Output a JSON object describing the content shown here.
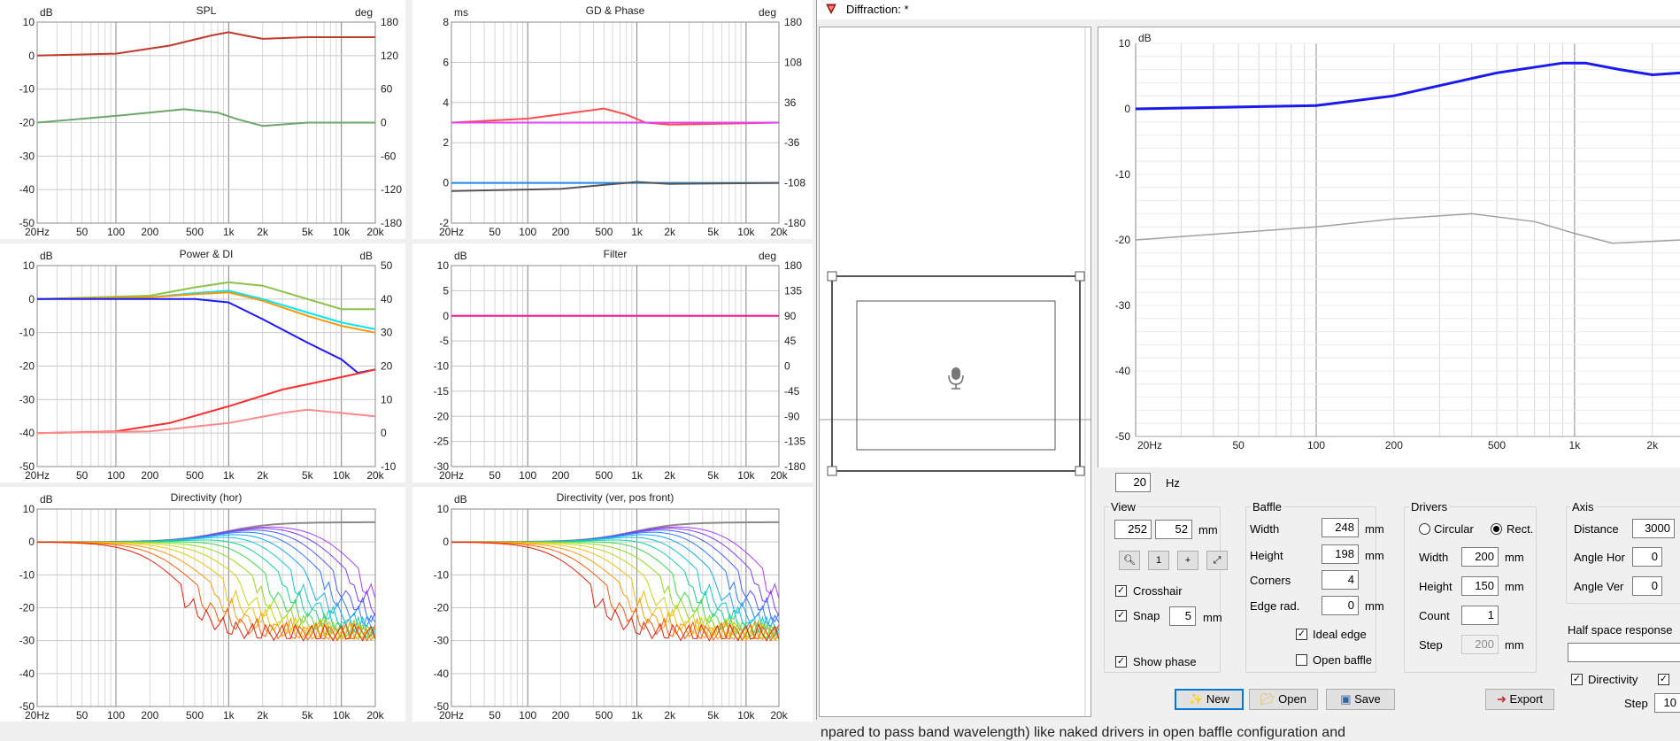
{
  "charts": [
    {
      "id": "spl",
      "title": "SPL",
      "lunit": "dB",
      "runit": "deg",
      "lticks": [
        "10",
        "0",
        "-10",
        "-20",
        "-30",
        "-40",
        "-50"
      ],
      "rticks": [
        "180",
        "120",
        "60",
        "0",
        "-60",
        "-120",
        "-180"
      ],
      "xticks": [
        "20Hz",
        "50",
        "100",
        "200",
        "500",
        "1k",
        "2k",
        "5k",
        "10k",
        "20k"
      ]
    },
    {
      "id": "gd",
      "title": "GD & Phase",
      "lunit": "ms",
      "runit": "deg",
      "lticks": [
        "8",
        "6",
        "4",
        "2",
        "0",
        "-2"
      ],
      "rticks": [
        "180",
        "108",
        "36",
        "-36",
        "-108",
        "-180"
      ],
      "xticks": [
        "20Hz",
        "50",
        "100",
        "200",
        "500",
        "1k",
        "2k",
        "5k",
        "10k",
        "20k"
      ]
    },
    {
      "id": "power",
      "title": "Power & DI",
      "lunit": "dB",
      "runit": "dB",
      "lticks": [
        "10",
        "0",
        "-10",
        "-20",
        "-30",
        "-40",
        "-50"
      ],
      "rticks": [
        "50",
        "40",
        "30",
        "20",
        "10",
        "0",
        "-10"
      ],
      "xticks": [
        "20Hz",
        "50",
        "100",
        "200",
        "500",
        "1k",
        "2k",
        "5k",
        "10k",
        "20k"
      ]
    },
    {
      "id": "filter",
      "title": "Filter",
      "lunit": "dB",
      "runit": "deg",
      "lticks": [
        "10",
        "5",
        "0",
        "-5",
        "-10",
        "-15",
        "-20",
        "-25",
        "-30"
      ],
      "rticks": [
        "180",
        "135",
        "90",
        "45",
        "0",
        "-45",
        "-90",
        "-135",
        "-180"
      ],
      "xticks": [
        "20Hz",
        "50",
        "100",
        "200",
        "500",
        "1k",
        "2k",
        "5k",
        "10k",
        "20k"
      ]
    },
    {
      "id": "dirh",
      "title": "Directivity (hor)",
      "lunit": "dB",
      "runit": "",
      "lticks": [
        "10",
        "0",
        "-10",
        "-20",
        "-30",
        "-40",
        "-50"
      ],
      "rticks": [],
      "xticks": [
        "20Hz",
        "50",
        "100",
        "200",
        "500",
        "1k",
        "2k",
        "5k",
        "10k",
        "20k"
      ]
    },
    {
      "id": "dirv",
      "title": "Directivity (ver, pos front)",
      "lunit": "dB",
      "runit": "",
      "lticks": [
        "10",
        "0",
        "-10",
        "-20",
        "-30",
        "-40",
        "-50"
      ],
      "rticks": [],
      "xticks": [
        "20Hz",
        "50",
        "100",
        "200",
        "500",
        "1k",
        "2k",
        "5k",
        "10k",
        "20k"
      ]
    }
  ],
  "chart_data": [
    {
      "type": "line",
      "title": "SPL",
      "ylim": [
        -50,
        10
      ],
      "y2lim": [
        -180,
        180
      ],
      "series": [
        {
          "color": "#c0392b",
          "values": [
            [
              20,
              0
            ],
            [
              100,
              0.6
            ],
            [
              300,
              3
            ],
            [
              700,
              6
            ],
            [
              1000,
              7
            ],
            [
              1400,
              6
            ],
            [
              2000,
              5
            ],
            [
              5000,
              5.5
            ],
            [
              20000,
              5.5
            ]
          ]
        },
        {
          "color": "#6aa86a",
          "values": [
            [
              20,
              -20
            ],
            [
              100,
              -18
            ],
            [
              400,
              -16
            ],
            [
              800,
              -17
            ],
            [
              1200,
              -19
            ],
            [
              2000,
              -21
            ],
            [
              5000,
              -20
            ],
            [
              20000,
              -20
            ]
          ]
        }
      ]
    },
    {
      "type": "line",
      "title": "GD & Phase",
      "ylim": [
        -2,
        8
      ],
      "y2lim": [
        -180,
        180
      ],
      "series": [
        {
          "color": "#ff4d4d",
          "values": [
            [
              20,
              3
            ],
            [
              100,
              3.2
            ],
            [
              500,
              3.7
            ],
            [
              800,
              3.4
            ],
            [
              1200,
              3
            ],
            [
              2000,
              2.9
            ],
            [
              20000,
              3
            ]
          ]
        },
        {
          "color": "#e040fb",
          "values": [
            [
              20,
              3
            ],
            [
              20000,
              3
            ]
          ]
        },
        {
          "color": "#1e88e5",
          "values": [
            [
              20,
              0
            ],
            [
              20000,
              0
            ]
          ]
        },
        {
          "color": "#555555",
          "values": [
            [
              20,
              -0.4
            ],
            [
              200,
              -0.3
            ],
            [
              500,
              -0.1
            ],
            [
              1000,
              0.05
            ],
            [
              2000,
              -0.05
            ],
            [
              20000,
              0
            ]
          ]
        }
      ]
    },
    {
      "type": "line",
      "title": "Power & DI",
      "ylim": [
        -50,
        10
      ],
      "y2lim": [
        -10,
        50
      ],
      "series": [
        {
          "color": "#8bc34a",
          "values": [
            [
              20,
              0
            ],
            [
              200,
              1
            ],
            [
              500,
              3.5
            ],
            [
              1000,
              5
            ],
            [
              2000,
              4
            ],
            [
              5000,
              0
            ],
            [
              10000,
              -3
            ],
            [
              20000,
              -3
            ]
          ]
        },
        {
          "color": "#00e5ff",
          "values": [
            [
              20,
              0
            ],
            [
              200,
              0.5
            ],
            [
              500,
              1.8
            ],
            [
              1000,
              2.5
            ],
            [
              2000,
              0
            ],
            [
              5000,
              -4
            ],
            [
              10000,
              -7
            ],
            [
              20000,
              -9
            ]
          ]
        },
        {
          "color": "#ff9800",
          "values": [
            [
              20,
              0
            ],
            [
              200,
              0.5
            ],
            [
              500,
              1.5
            ],
            [
              1000,
              2
            ],
            [
              2000,
              -0.5
            ],
            [
              5000,
              -5
            ],
            [
              10000,
              -8
            ],
            [
              20000,
              -10
            ]
          ]
        },
        {
          "color": "#1a1aff",
          "values": [
            [
              20,
              0
            ],
            [
              500,
              0
            ],
            [
              1000,
              -1
            ],
            [
              2000,
              -6
            ],
            [
              5000,
              -13
            ],
            [
              10000,
              -18
            ],
            [
              14000,
              -22
            ],
            [
              20000,
              -21
            ]
          ]
        },
        {
          "color": "#ff2d2d",
          "values": [
            [
              20,
              -40
            ],
            [
              100,
              -39.5
            ],
            [
              300,
              -37
            ],
            [
              1000,
              -32
            ],
            [
              3000,
              -27
            ],
            [
              8000,
              -24
            ],
            [
              15000,
              -22
            ],
            [
              20000,
              -21
            ]
          ]
        },
        {
          "color": "#ff8a8a",
          "values": [
            [
              20,
              -40
            ],
            [
              200,
              -39.5
            ],
            [
              1000,
              -37
            ],
            [
              3000,
              -34
            ],
            [
              5000,
              -33
            ],
            [
              10000,
              -34
            ],
            [
              20000,
              -35
            ]
          ]
        }
      ]
    },
    {
      "type": "line",
      "title": "Filter",
      "ylim": [
        -30,
        10
      ],
      "y2lim": [
        -180,
        180
      ],
      "series": [
        {
          "color": "#ff1493",
          "values": [
            [
              20,
              0
            ],
            [
              20000,
              0
            ]
          ]
        }
      ]
    },
    {
      "type": "line",
      "title": "Directivity (hor)",
      "ylim": [
        -50,
        10
      ],
      "series": []
    },
    {
      "type": "line",
      "title": "Directivity (ver, pos front)",
      "ylim": [
        -50,
        10
      ],
      "series": []
    },
    {
      "type": "line",
      "title": "",
      "ylim": [
        -50,
        10
      ],
      "xlim": [
        20,
        2600
      ],
      "series": [
        {
          "color": "#1a1aee",
          "values": [
            [
              20,
              0
            ],
            [
              100,
              0.5
            ],
            [
              200,
              2
            ],
            [
              500,
              5.5
            ],
            [
              900,
              7
            ],
            [
              1100,
              7
            ],
            [
              1500,
              6
            ],
            [
              2000,
              5.2
            ],
            [
              2600,
              5.5
            ]
          ]
        },
        {
          "color": "#a0a0a0",
          "values": [
            [
              20,
              -20
            ],
            [
              100,
              -18
            ],
            [
              200,
              -16.8
            ],
            [
              400,
              -16
            ],
            [
              700,
              -17.2
            ],
            [
              1000,
              -19
            ],
            [
              1400,
              -20.5
            ],
            [
              1800,
              -20.3
            ],
            [
              2600,
              -20
            ]
          ]
        }
      ]
    }
  ],
  "bigchart": {
    "unit": "dB",
    "yticks": [
      "10",
      "0",
      "-10",
      "-20",
      "-30",
      "-40",
      "-50"
    ],
    "xticks": [
      "20Hz",
      "50",
      "100",
      "200",
      "500",
      "1k",
      "2k"
    ]
  },
  "window": {
    "title": "Diffraction: *"
  },
  "freq": {
    "value": "20",
    "unit": "Hz"
  },
  "view": {
    "title": "View",
    "x": "252",
    "y": "52",
    "unit": "mm",
    "crosshair": "Crosshair",
    "snap": "Snap",
    "snap_val": "5",
    "snap_unit": "mm",
    "show_phase": "Show phase"
  },
  "baffle": {
    "title": "Baffle",
    "width_label": "Width",
    "width": "248",
    "height_label": "Height",
    "height": "198",
    "corners_label": "Corners",
    "corners": "4",
    "edge_label": "Edge rad.",
    "edge": "0",
    "unit": "mm",
    "ideal_edge": "Ideal edge",
    "open_baffle": "Open baffle"
  },
  "drivers": {
    "title": "Drivers",
    "circular": "Circular",
    "rect": "Rect.",
    "width_label": "Width",
    "width": "200",
    "height_label": "Height",
    "height": "150",
    "count_label": "Count",
    "count": "1",
    "step_label": "Step",
    "step": "200",
    "unit": "mm"
  },
  "axis": {
    "title": "Axis",
    "distance_label": "Distance",
    "distance": "3000",
    "angle_hor_label": "Angle Hor",
    "angle_hor": "0",
    "angle_ver_label": "Angle Ver",
    "angle_ver": "0"
  },
  "half_space": {
    "label": "Half space response",
    "value": ""
  },
  "directivity": {
    "label": "Directivity",
    "step_label": "Step",
    "step": "10"
  },
  "buttons": {
    "new": "New",
    "open": "Open",
    "save": "Save",
    "export": "Export"
  },
  "caption": {
    "text": "npared to pass band wavelength) like naked drivers in open baffle configuration and"
  }
}
